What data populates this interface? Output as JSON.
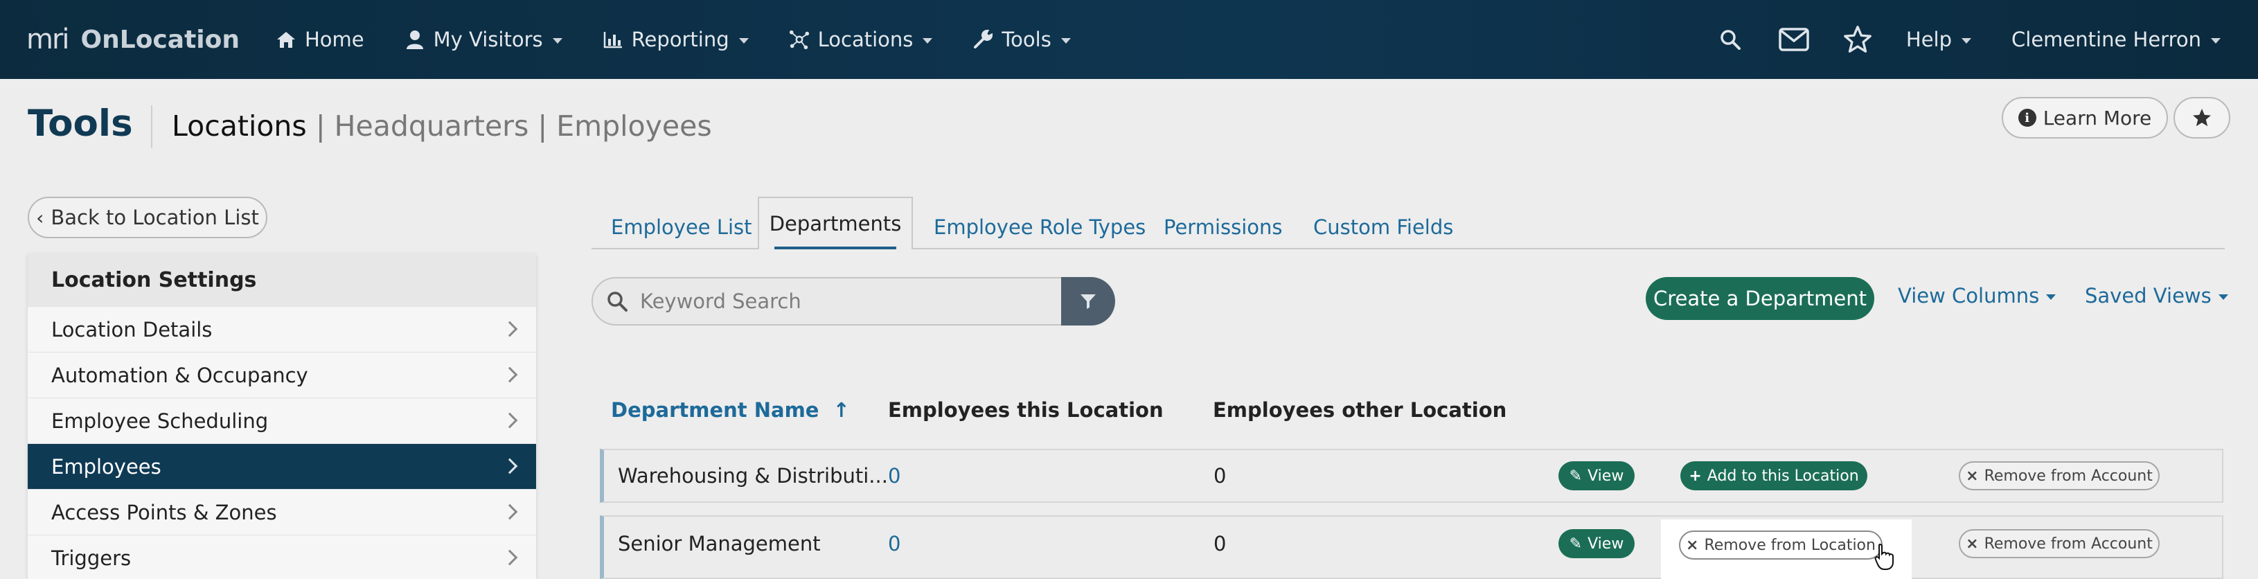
{
  "navbar": {
    "brand_mark": "mri",
    "brand_name": "OnLocation",
    "items": [
      {
        "label": "Home",
        "icon": "home-icon",
        "dropdown": false
      },
      {
        "label": "My Visitors",
        "icon": "user-icon",
        "dropdown": true
      },
      {
        "label": "Reporting",
        "icon": "bar-chart-icon",
        "dropdown": true
      },
      {
        "label": "Locations",
        "icon": "network-icon",
        "dropdown": true
      },
      {
        "label": "Tools",
        "icon": "wrench-icon",
        "dropdown": true
      }
    ],
    "help_label": "Help",
    "user_name": "Clementine Herron"
  },
  "header": {
    "title": "Tools",
    "crumb_current": "Locations",
    "crumb_rest": "| Headquarters | Employees",
    "learn_more": "Learn More"
  },
  "sidebar": {
    "back_label": "Back to Location List",
    "heading": "Location Settings",
    "items": [
      {
        "label": "Location Details"
      },
      {
        "label": "Automation & Occupancy"
      },
      {
        "label": "Employee Scheduling"
      },
      {
        "label": "Employees",
        "active": true
      },
      {
        "label": "Access Points & Zones"
      },
      {
        "label": "Triggers"
      }
    ]
  },
  "tabs": [
    {
      "label": "Employee List"
    },
    {
      "label": "Departments",
      "active": true
    },
    {
      "label": "Employee Role Types"
    },
    {
      "label": "Permissions"
    },
    {
      "label": "Custom Fields"
    }
  ],
  "toolbar": {
    "search_placeholder": "Keyword Search",
    "create_label": "Create a Department",
    "view_columns": "View Columns",
    "saved_views": "Saved Views"
  },
  "table": {
    "columns": [
      "Department Name",
      "Employees this Location",
      "Employees other Location"
    ],
    "sort_indicator": "↑",
    "rows": [
      {
        "name": "Warehousing & Distributi...",
        "this_location": "0",
        "other_location": "0",
        "view": "View",
        "location_action": "Add to this Location",
        "account_action": "Remove from Account"
      },
      {
        "name": "Senior Management",
        "this_location": "0",
        "other_location": "0",
        "view": "View",
        "location_action": "Remove from Location",
        "account_action": "Remove from Account"
      }
    ]
  },
  "colors": {
    "navbar": "#0e3550",
    "accent_green": "#1b6e55",
    "link_blue": "#1d6a9a",
    "sidebar_active": "#0f3a54"
  }
}
